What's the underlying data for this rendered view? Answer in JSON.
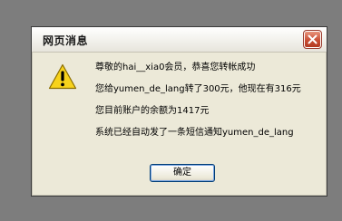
{
  "dialog": {
    "title": "网页消息",
    "close_icon": "close-icon",
    "warning_icon": "warning-icon",
    "messages": [
      "尊敬的hai__xia0会员，恭喜您转帐成功",
      "您给yumen_de_lang转了300元，他现在有316元",
      "您目前账户的余额为1417元",
      "系统已经自动发了一条短信通知yumen_de_lang"
    ],
    "ok_label": "确定"
  },
  "colors": {
    "desktop_background": "#7d7d7d",
    "dialog_background": "#ece9d8",
    "close_button": "#c94f35",
    "warning_yellow": "#f7d21c"
  }
}
